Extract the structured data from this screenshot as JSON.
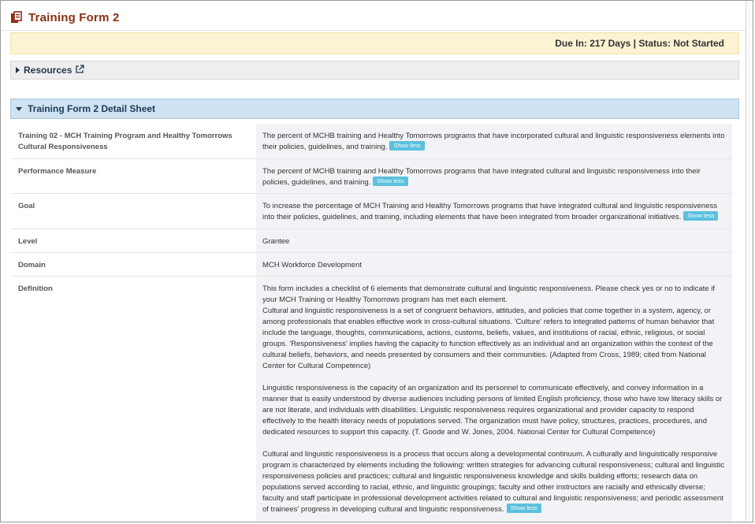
{
  "page": {
    "title": "Training Form 2",
    "icon": "form-copy-icon",
    "accent_color": "#8b2f12"
  },
  "status_bar": {
    "text": "Due In: 217 Days | Status: Not Started"
  },
  "resources": {
    "label": "Resources",
    "icon": "external-link-icon"
  },
  "detail_sheet": {
    "label": "Training Form 2 Detail Sheet",
    "show_less_label": "Show less",
    "rows": [
      {
        "label": "Training 02 - MCH Training Program and Healthy Tomorrows Cultural Responsiveness",
        "value": "The percent of MCHB training and Healthy Tomorrows programs that have incorporated cultural and linguistic responsiveness elements into their policies, guidelines, and training."
      },
      {
        "label": "Performance Measure",
        "value": "The percent of MCHB training and Healthy Tomorrows programs that have integrated cultural and linguistic responsiveness into their policies, guidelines, and training."
      },
      {
        "label": "Goal",
        "value": "To increase the percentage of MCH Training and Healthy Tomorrows programs that have integrated cultural and linguistic responsiveness into their policies, guidelines, and training, including elements that have been integrated from broader organizational initiatives."
      },
      {
        "label": "Level",
        "value": "Grantee"
      },
      {
        "label": "Domain",
        "value": "MCH Workforce Development"
      },
      {
        "label": "Definition",
        "p1": "This form includes a checklist of 6 elements that demonstrate cultural and linguistic responsiveness. Please check yes or no to indicate if your MCH Training or Healthy Tomorrows program has met each element.",
        "p2": "Cultural and linguistic responsiveness is a set of congruent behaviors, attitudes, and policies that come together in a system, agency, or among professionals that enables effective work in cross-cultural situations. 'Culture' refers to integrated patterns of human behavior that include the language, thoughts, communications, actions, customs, beliefs, values, and institutions of racial, ethnic, religious, or social groups. 'Responsiveness' implies having the capacity to function effectively as an individual and an organization within the context of the cultural beliefs, behaviors, and needs presented by consumers and their communities. (Adapted from Cross, 1989; cited from National Center for Cultural Competence)",
        "p3": "Linguistic responsiveness is the capacity of an organization and its personnel to communicate effectively, and convey information in a manner that is easily understood by diverse audiences including persons of limited English proficiency, those who have low literacy skills or are not literate, and individuals with disabilities. Linguistic responsiveness requires organizational and provider capacity to respond effectively to the health literacy needs of populations served. The organization must have policy, structures, practices, procedures, and dedicated resources to support this capacity. (T. Goode and W. Jones, 2004. National Center for Cultural Competence)",
        "p4": "Cultural and linguistic responsiveness is a process that occurs along a developmental continuum. A culturally and linguistically responsive program is characterized by elements including the following: written strategies for advancing cultural responsiveness; cultural and linguistic responsiveness policies and practices; cultural and linguistic responsiveness knowledge and skills building efforts; research data on populations served according to racial, ethnic, and linguistic groupings; faculty and other instructors are racially and ethnically diverse; faculty and staff participate in professional development activities related to cultural and linguistic responsiveness; and periodic assessment of trainees' progress in developing cultural and linguistic responsiveness."
      }
    ]
  }
}
